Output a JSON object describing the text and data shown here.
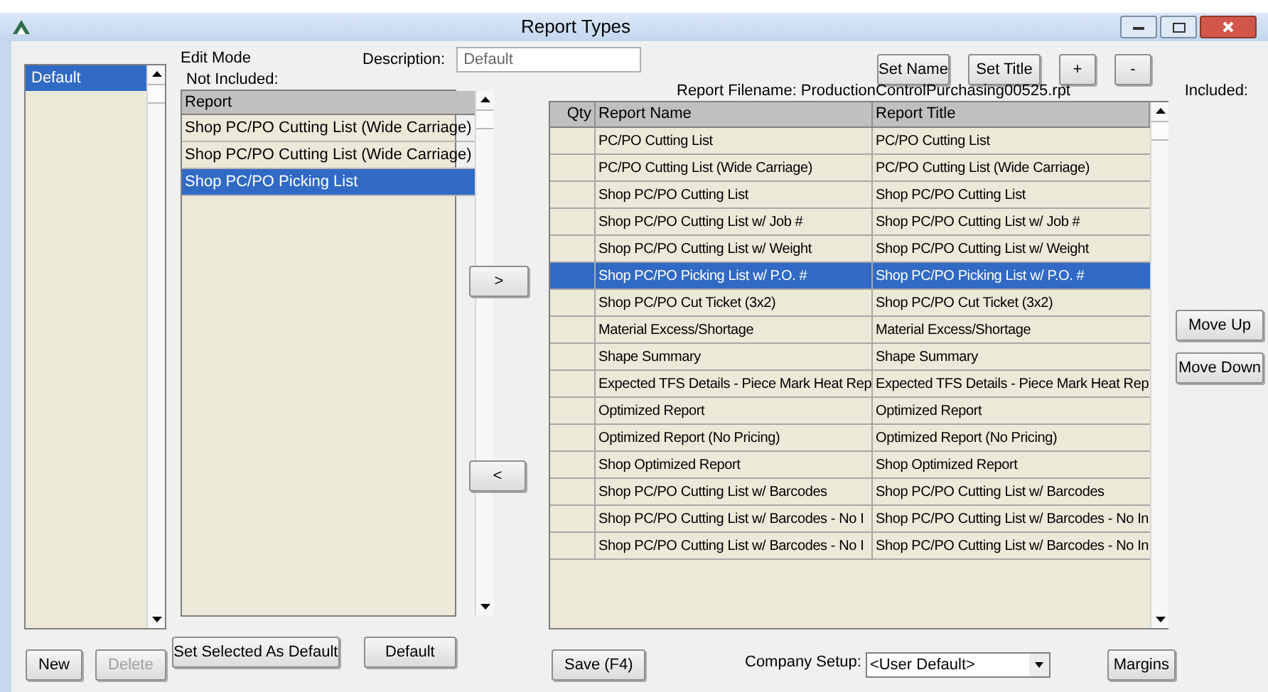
{
  "window": {
    "title": "Report Types"
  },
  "profiles": [
    {
      "label": "Default",
      "selected": true
    }
  ],
  "edit_mode_label": "Edit Mode",
  "not_included_label": "Not Included:",
  "description": {
    "label": "Description:",
    "value": "Default"
  },
  "top_buttons": [
    "Set Name",
    "Set Title",
    "+",
    "-"
  ],
  "report_filename": "Report Filename: ProductionControlPurchasing00525.rpt",
  "included_label": "Included:",
  "not_included": {
    "column": "Report",
    "items": [
      {
        "label": "Shop PC/PO Cutting List (Wide Carriage)",
        "selected": false
      },
      {
        "label": "Shop PC/PO Cutting List (Wide Carriage)",
        "selected": false
      },
      {
        "label": "Shop PC/PO Picking List",
        "selected": true
      }
    ]
  },
  "transfer_buttons": [
    ">",
    "<"
  ],
  "included": {
    "columns": [
      "Qty",
      "Report Name",
      "Report Title"
    ],
    "rows": [
      {
        "name": "PC/PO Cutting List",
        "title": "PC/PO Cutting List",
        "selected": false
      },
      {
        "name": "PC/PO Cutting List (Wide Carriage)",
        "title": "PC/PO Cutting List (Wide Carriage)",
        "selected": false
      },
      {
        "name": "Shop PC/PO Cutting List",
        "title": "Shop PC/PO Cutting List",
        "selected": false
      },
      {
        "name": "Shop PC/PO Cutting List w/ Job #",
        "title": "Shop PC/PO Cutting List w/ Job #",
        "selected": false
      },
      {
        "name": "Shop PC/PO Cutting List w/ Weight",
        "title": "Shop PC/PO Cutting List w/ Weight",
        "selected": false
      },
      {
        "name": "Shop PC/PO Picking List w/ P.O. #",
        "title": "Shop PC/PO Picking List w/ P.O. #",
        "selected": true
      },
      {
        "name": "Shop PC/PO Cut Ticket (3x2)",
        "title": "Shop PC/PO Cut Ticket (3x2)",
        "selected": false
      },
      {
        "name": "Material Excess/Shortage",
        "title": "Material Excess/Shortage",
        "selected": false
      },
      {
        "name": "Shape Summary",
        "title": "Shape Summary",
        "selected": false
      },
      {
        "name": "Expected TFS Details - Piece Mark Heat Rep",
        "title": "Expected TFS Details - Piece Mark Heat Rep",
        "selected": false
      },
      {
        "name": "Optimized Report",
        "title": "Optimized Report",
        "selected": false
      },
      {
        "name": "Optimized Report (No Pricing)",
        "title": "Optimized Report (No Pricing)",
        "selected": false
      },
      {
        "name": "Shop Optimized Report",
        "title": "Shop Optimized Report",
        "selected": false
      },
      {
        "name": "Shop PC/PO Cutting List w/ Barcodes",
        "title": "Shop PC/PO Cutting List w/ Barcodes",
        "selected": false
      },
      {
        "name": "Shop PC/PO Cutting List w/ Barcodes - No I",
        "title": "Shop PC/PO Cutting List w/ Barcodes - No In",
        "selected": false
      },
      {
        "name": "Shop PC/PO Cutting List w/ Barcodes - No I",
        "title": "Shop PC/PO Cutting List w/ Barcodes - No In",
        "selected": false
      }
    ]
  },
  "side_buttons": [
    "Move Up",
    "Move Down"
  ],
  "profile_buttons": [
    {
      "label": "New",
      "disabled": false
    },
    {
      "label": "Delete",
      "disabled": true
    }
  ],
  "footer_buttons": [
    "Set Selected As Default",
    "Default",
    "Save (F4)"
  ],
  "company_setup": {
    "label": "Company Setup:",
    "value": "<User Default>"
  },
  "margins_button": "Margins"
}
